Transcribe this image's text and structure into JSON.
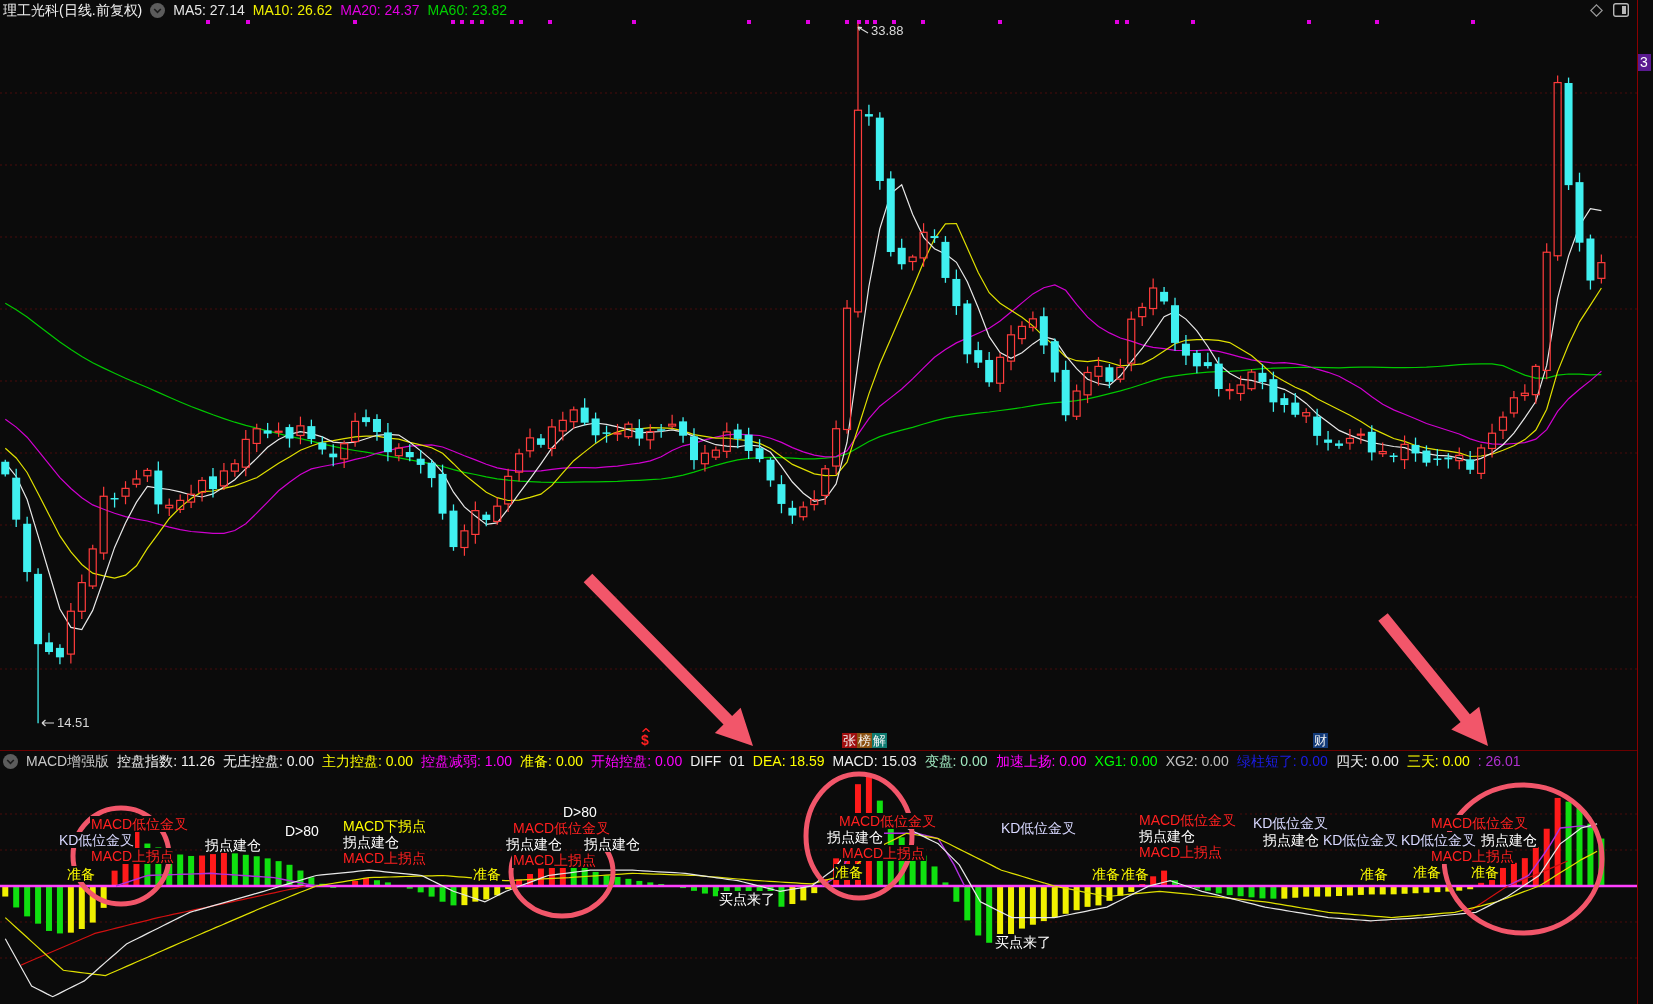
{
  "main_chart": {
    "title": "理工光科(日线.前复权)",
    "legend": [
      {
        "text": "MA5: 27.14",
        "color": "#e6e6e6"
      },
      {
        "text": "MA10: 26.62",
        "color": "#f0f000"
      },
      {
        "text": "MA20: 24.37",
        "color": "#e000e0"
      },
      {
        "text": "MA60: 23.82",
        "color": "#00d000"
      }
    ],
    "high_label": "33.88",
    "low_label": "14.51",
    "event_tags": [
      {
        "kind": "symbol",
        "text": "$",
        "color": "#ff2020"
      },
      {
        "kind": "tag",
        "text": "张",
        "color": "#a01010"
      },
      {
        "kind": "tag",
        "text": "榜",
        "color": "#8a5010"
      },
      {
        "kind": "tag",
        "text": "解",
        "color": "#0e7a70"
      },
      {
        "kind": "tag",
        "text": "财",
        "color": "#123a78"
      }
    ]
  },
  "price_axis": {
    "label": "3"
  },
  "indicator": {
    "name": "MACD增强版",
    "legend": [
      {
        "text": "控盘指数: 11.26",
        "color": "#f0f0f0"
      },
      {
        "text": "无庄控盘: 0.00",
        "color": "#f0f0f0"
      },
      {
        "text": "主力控盘: 0.00",
        "color": "#ffff00"
      },
      {
        "text": "控盘减弱: 1.00",
        "color": "#ff00ff"
      },
      {
        "text": "准备: 0.00",
        "color": "#ffff00"
      },
      {
        "text": "开始控盘: 0.00",
        "color": "#ff00ff"
      },
      {
        "text": "DIFF",
        "color": "#f0f0f0"
      },
      {
        "text": "01",
        "color": "#f0f0f0"
      },
      {
        "text": "DEA: 18.59",
        "color": "#ffff00"
      },
      {
        "text": "MACD: 15.03",
        "color": "#f0f0f0"
      },
      {
        "text": "变盘: 0.00",
        "color": "#a0e8c0"
      },
      {
        "text": "加速上扬: 0.00",
        "color": "#ff00ff"
      },
      {
        "text": "XG1: 0.00",
        "color": "#00ff00"
      },
      {
        "text": "XG2: 0.00",
        "color": "#c0c0c0"
      },
      {
        "text": "绿柱短了: 0.00",
        "color": "#1c1ce8"
      },
      {
        "text": "四天: 0.00",
        "color": "#f0f0f0"
      },
      {
        "text": "三天: 0.00",
        "color": "#ffff00"
      },
      {
        "text": ": 26.01",
        "color": "#b030d0"
      }
    ],
    "signals": [
      {
        "text": "MACD低位金叉",
        "color": "#ff2020"
      },
      {
        "text": "D>80",
        "color": "#ffffff"
      },
      {
        "text": "KD低位金叉",
        "color": "#d8d8ff"
      },
      {
        "text": "拐点建仓",
        "color": "#ffffff"
      },
      {
        "text": "MACD上拐点",
        "color": "#ff2020"
      },
      {
        "text": "准备",
        "color": "#ffff00"
      },
      {
        "text": "MACD下拐点",
        "color": "#ffff00"
      },
      {
        "text": "拐点建仓",
        "color": "#ffffff"
      },
      {
        "text": "MACD上拐点",
        "color": "#ff2020"
      },
      {
        "text": "D>80",
        "color": "#ffffff"
      },
      {
        "text": "MACD低位金叉",
        "color": "#ff2020"
      },
      {
        "text": "拐点建仓",
        "color": "#ffffff"
      },
      {
        "text": "拐点建仓",
        "color": "#ffffff"
      },
      {
        "text": "MACD上拐点",
        "color": "#ff2020"
      },
      {
        "text": "准备",
        "color": "#ffff00"
      },
      {
        "text": "买点来了",
        "color": "#ffffff"
      },
      {
        "text": "MACD低位金叉",
        "color": "#ff2020"
      },
      {
        "text": "拐点建仓",
        "color": "#ffffff"
      },
      {
        "text": "MACD上拐点",
        "color": "#ff2020"
      },
      {
        "text": "准备",
        "color": "#ffff00"
      },
      {
        "text": "KD低位金叉",
        "color": "#d8d8ff"
      },
      {
        "text": "买点来了",
        "color": "#ffffff"
      },
      {
        "text": "MACD低位金叉",
        "color": "#ff2020"
      },
      {
        "text": "拐点建仓",
        "color": "#ffffff"
      },
      {
        "text": "MACD上拐点",
        "color": "#ff2020"
      },
      {
        "text": "准备",
        "color": "#ffff00"
      },
      {
        "text": "准备",
        "color": "#ffff00"
      },
      {
        "text": "KD低位金叉",
        "color": "#d8d8ff"
      },
      {
        "text": "MACD低位金叉",
        "color": "#ff2020"
      },
      {
        "text": "拐点建仓",
        "color": "#ffffff"
      },
      {
        "text": "KD低位金叉",
        "color": "#d8d8ff"
      },
      {
        "text": "KD低位金叉",
        "color": "#d8d8ff"
      },
      {
        "text": "拐点建仓",
        "color": "#ffffff"
      },
      {
        "text": "MACD上拐点",
        "color": "#ff2020"
      },
      {
        "text": "准备",
        "color": "#ffff00"
      },
      {
        "text": "准备",
        "color": "#ffff00"
      },
      {
        "text": "准备",
        "color": "#ffff00"
      }
    ]
  }
}
